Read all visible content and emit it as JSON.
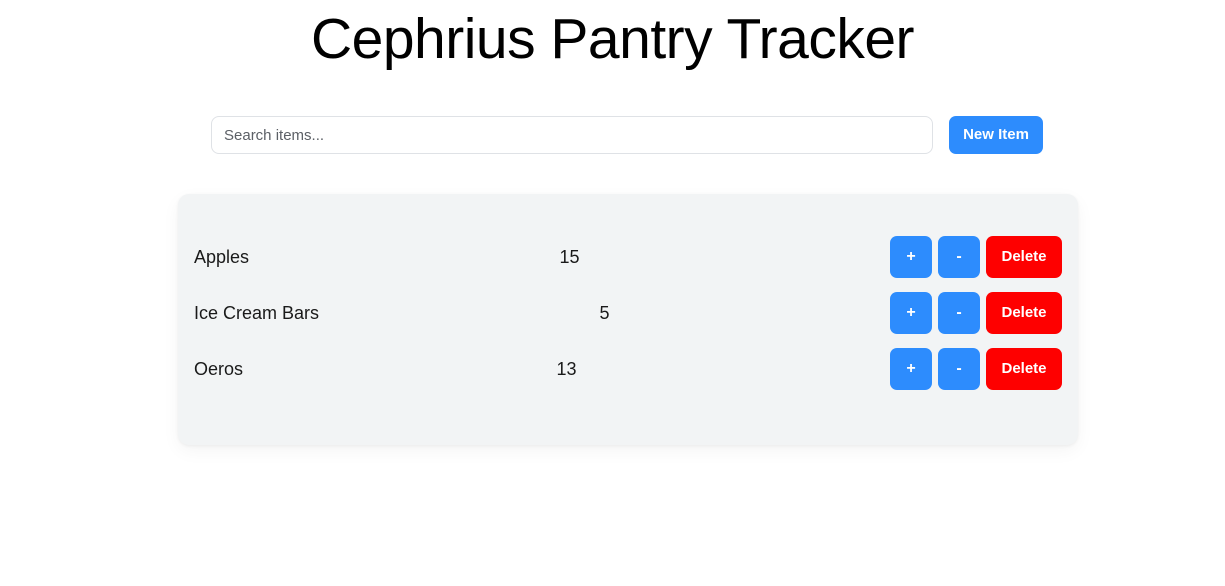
{
  "app": {
    "title": "Cephrius Pantry Tracker"
  },
  "toolbar": {
    "search_placeholder": "Search items...",
    "search_value": "",
    "new_item_label": "New Item"
  },
  "colors": {
    "page_background": "#ffffff",
    "card_background": "#f2f4f5",
    "accent_blue": "#2d8cfd",
    "danger_red": "#fe0000",
    "text": "#1a1a1a",
    "placeholder": "#5c6066",
    "input_border": "#dfe2e6"
  },
  "actions": {
    "increment_label": "+",
    "decrement_label": "-",
    "delete_label": "Delete"
  },
  "items": [
    {
      "name": "Apples",
      "quantity": "15"
    },
    {
      "name": "Ice Cream Bars",
      "quantity": "5"
    },
    {
      "name": "Oeros",
      "quantity": "13"
    }
  ]
}
